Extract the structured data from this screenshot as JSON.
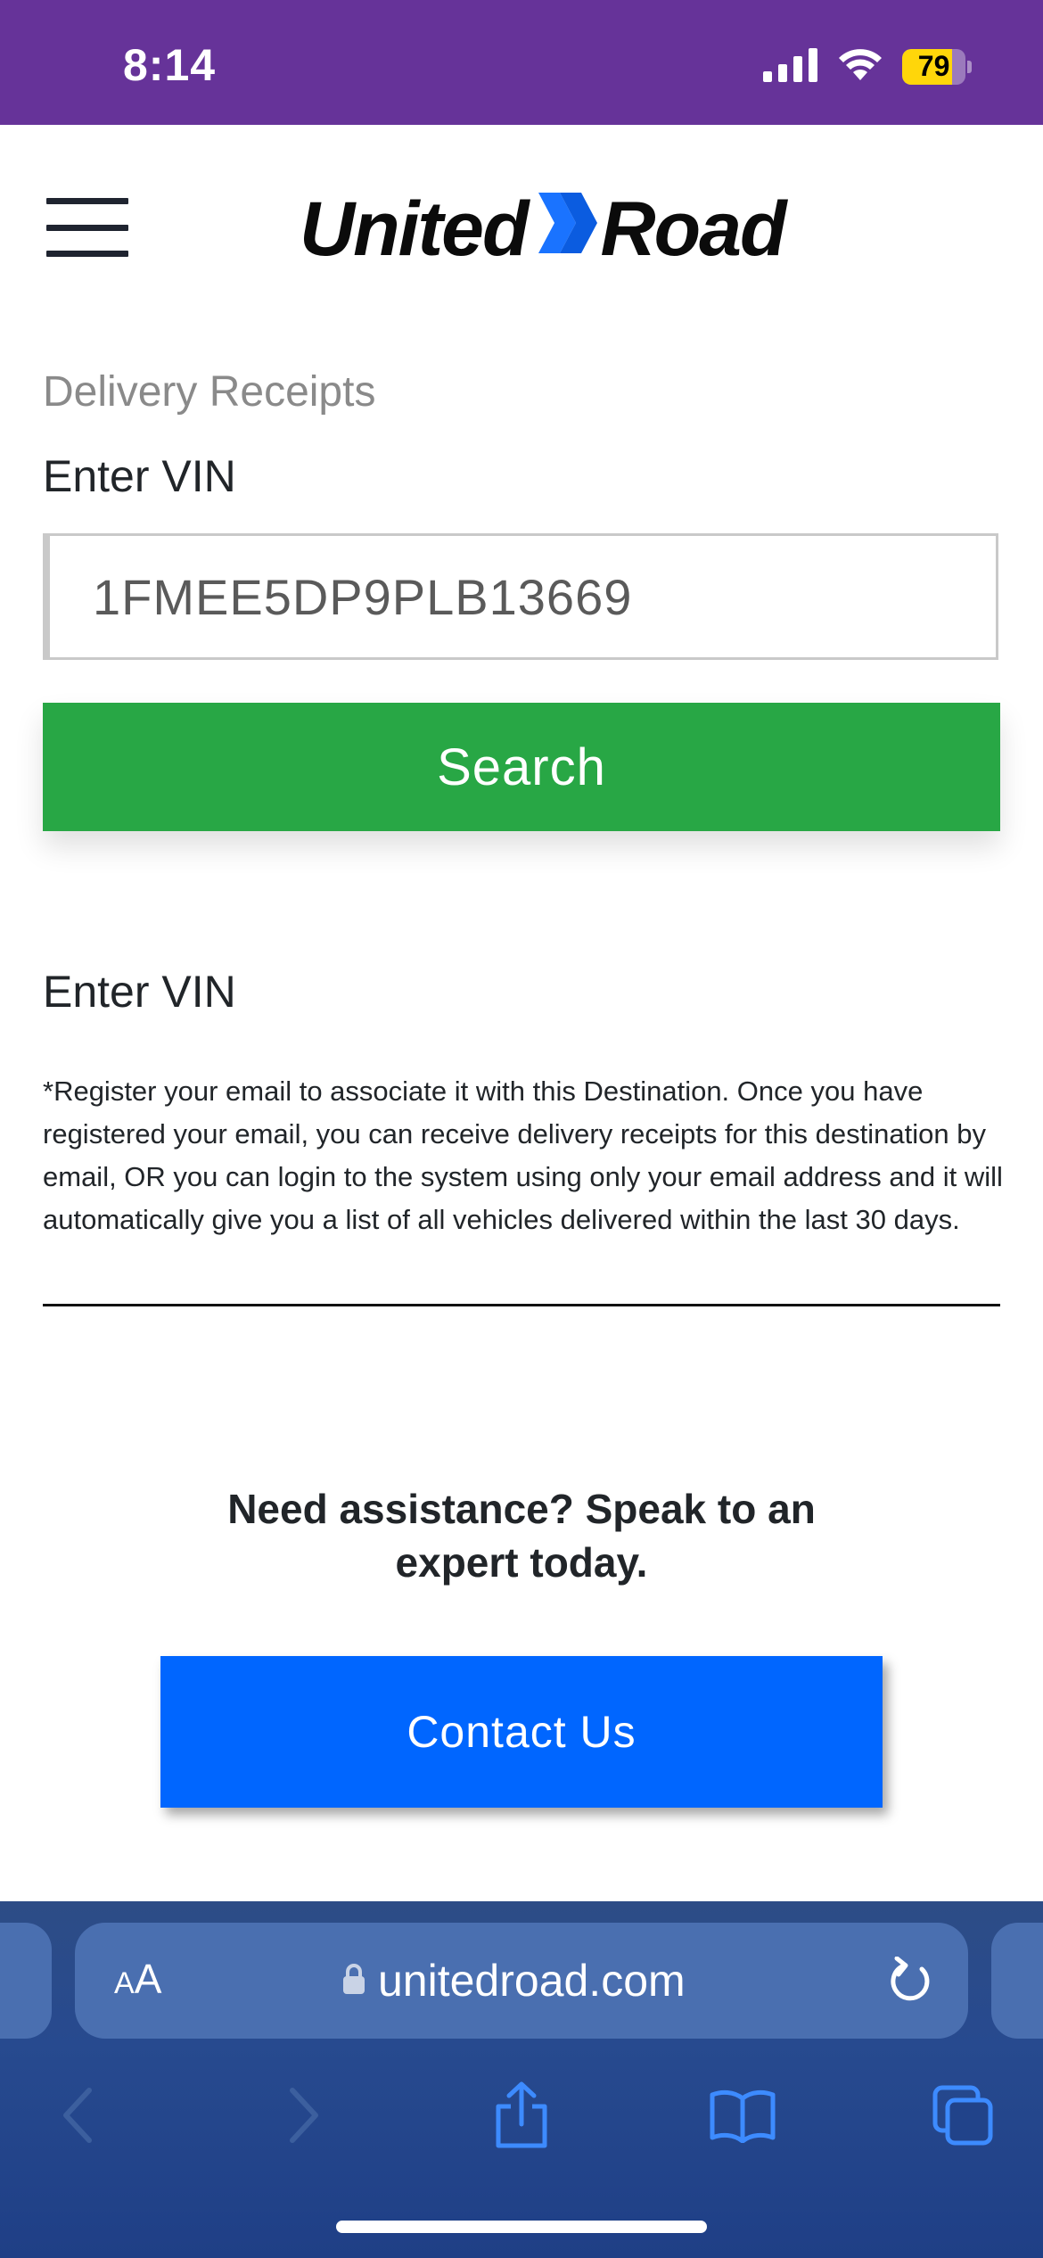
{
  "status_bar": {
    "time": "8:14",
    "battery_level": "79",
    "background_color": "#663399",
    "battery_color": "#ffd60a",
    "icons": [
      "cellular-signal-icon",
      "wifi-icon",
      "battery-icon"
    ]
  },
  "header": {
    "menu_icon": "hamburger-menu-icon",
    "logo": {
      "left_text": "United",
      "right_text": "Road",
      "mark_icon": "chevron-mark-icon",
      "mark_color": "#1a73ff"
    }
  },
  "form": {
    "section_label": "Delivery Receipts",
    "vin_label": "Enter VIN",
    "vin_value": "1FMEE5DP9PLB13669",
    "search_label": "Search",
    "search_color": "#28a745"
  },
  "info": {
    "heading": "Enter VIN",
    "note": "*Register your email to associate it with this Destination. Once you have registered your email, you can receive delivery receipts for this destination by email, OR you can login to the system using only your email address and it will automatically give you a list of all vehicles delivered within the last 30 days."
  },
  "assistance": {
    "heading": "Need assistance? Speak to an expert today.",
    "contact_label": "Contact Us",
    "contact_color": "#0066ff"
  },
  "browser": {
    "text_size_label_small": "A",
    "text_size_label_large": "A",
    "url": "unitedroad.com",
    "icons": [
      "lock-icon",
      "reload-icon",
      "back-icon",
      "forward-icon",
      "share-icon",
      "bookmarks-icon",
      "tabs-icon"
    ],
    "toolbar_color": "#2d4c86"
  }
}
